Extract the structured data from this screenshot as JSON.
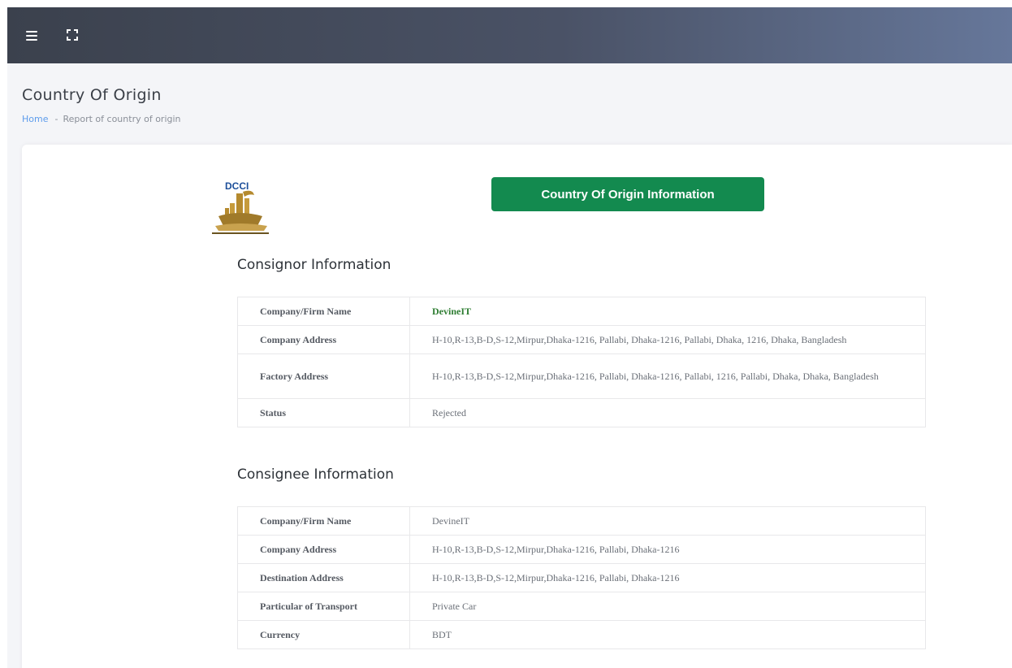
{
  "topbar": {
    "menu_icon": "hamburger-menu-icon",
    "fullscreen_icon": "fullscreen-expand-icon"
  },
  "header": {
    "title": "Country Of Origin",
    "breadcrumb": {
      "home": "Home",
      "separator": "-",
      "current": "Report of country of origin"
    }
  },
  "report": {
    "logo_text": "DCCI",
    "title": "Country Of Origin Information",
    "consignor": {
      "heading": "Consignor Information",
      "rows": [
        {
          "label": "Company/Firm Name",
          "value": "DevineIT"
        },
        {
          "label": "Company Address",
          "value": "H-10,R-13,B-D,S-12,Mirpur,Dhaka-1216, Pallabi, Dhaka-1216, Pallabi, Dhaka, 1216, Dhaka, Bangladesh"
        },
        {
          "label": "Factory Address",
          "value": "H-10,R-13,B-D,S-12,Mirpur,Dhaka-1216, Pallabi, Dhaka-1216, Pallabi, 1216, Pallabi, Dhaka, Dhaka, Bangladesh"
        },
        {
          "label": "Status",
          "value": "Rejected"
        }
      ]
    },
    "consignee": {
      "heading": "Consignee Information",
      "rows": [
        {
          "label": "Company/Firm Name",
          "value": "DevineIT"
        },
        {
          "label": "Company Address",
          "value": "H-10,R-13,B-D,S-12,Mirpur,Dhaka-1216, Pallabi, Dhaka-1216"
        },
        {
          "label": "Destination Address",
          "value": "H-10,R-13,B-D,S-12,Mirpur,Dhaka-1216, Pallabi, Dhaka-1216"
        },
        {
          "label": "Particular of Transport",
          "value": "Private Car"
        },
        {
          "label": "Currency",
          "value": "BDT"
        }
      ]
    }
  },
  "colors": {
    "accent_green": "#138a4f",
    "link_blue": "#5d9cec",
    "highlight_green": "#2e7d32"
  }
}
